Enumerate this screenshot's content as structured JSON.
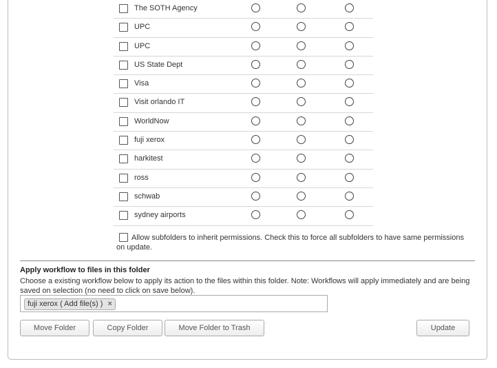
{
  "permissions": {
    "rows": [
      {
        "label": "The SOTH Agency"
      },
      {
        "label": "UPC"
      },
      {
        "label": "UPC"
      },
      {
        "label": "US State Dept"
      },
      {
        "label": "Visa"
      },
      {
        "label": "Visit orlando IT"
      },
      {
        "label": "WorldNow"
      },
      {
        "label": "fuji xerox"
      },
      {
        "label": "harkitest"
      },
      {
        "label": "ross"
      },
      {
        "label": "schwab"
      },
      {
        "label": "sydney airports"
      }
    ],
    "inherit_label": "Allow subfolders to inherit permissions. Check this to force all subfolders to have same permissions on update."
  },
  "workflow": {
    "heading": "Apply workflow to files in this folder",
    "description": "Choose a existing workflow below to apply its action to the files within this folder. Note: Workflows will apply immediately and are being saved on selection (no need to click on save below).",
    "selected_token": "fuji xerox ( Add file(s) )",
    "token_remove": "×"
  },
  "buttons": {
    "move_folder": "Move Folder",
    "copy_folder": "Copy Folder",
    "move_to_trash": "Move Folder to Trash",
    "update": "Update"
  },
  "icons": {
    "checkbox": "checkbox-unchecked-icon",
    "radio": "radio-unselected-icon",
    "remove": "close-icon"
  }
}
